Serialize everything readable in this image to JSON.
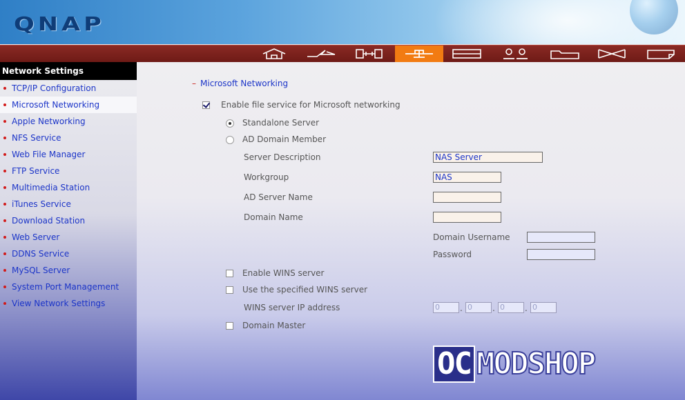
{
  "header": {
    "logo": "QNAP"
  },
  "nav": {
    "icons": [
      "home-icon",
      "lightning-icon",
      "connector-icon",
      "network-icon",
      "storage-icon",
      "users-icon",
      "folder-icon",
      "bowtie-icon",
      "document-icon"
    ],
    "active_index": 3,
    "accent_color": "#f27b12",
    "bar_color": "#7a201b"
  },
  "sidebar": {
    "title": "Network Settings",
    "items": [
      {
        "label": "TCP/IP Configuration"
      },
      {
        "label": "Microsoft Networking"
      },
      {
        "label": "Apple Networking"
      },
      {
        "label": "NFS Service"
      },
      {
        "label": "Web File Manager"
      },
      {
        "label": "FTP Service"
      },
      {
        "label": "Multimedia Station"
      },
      {
        "label": "iTunes Service"
      },
      {
        "label": "Download Station"
      },
      {
        "label": "Web Server"
      },
      {
        "label": "DDNS Service"
      },
      {
        "label": "MySQL Server"
      },
      {
        "label": "System Port Management"
      },
      {
        "label": "View Network Settings"
      }
    ],
    "selected_index": 1
  },
  "main": {
    "section_title": "Microsoft Networking",
    "enable_label": "Enable file service for Microsoft networking",
    "enable_checked": true,
    "standalone_label": "Standalone Server",
    "standalone_selected": true,
    "ad_member_label": "AD Domain Member",
    "server_description_label": "Server Description",
    "server_description_value": "NAS Server",
    "workgroup_label": "Workgroup",
    "workgroup_value": "NAS",
    "ad_server_name_label": "AD Server Name",
    "ad_server_name_value": "",
    "domain_name_label": "Domain Name",
    "domain_name_value": "",
    "domain_username_label": "Domain Username",
    "domain_username_value": "",
    "password_label": "Password",
    "password_value": "",
    "enable_wins_label": "Enable WINS server",
    "use_wins_label": "Use the specified WINS server",
    "wins_ip_label": "WINS server IP address",
    "wins_ip": [
      "0",
      "0",
      "0",
      "0"
    ],
    "domain_master_label": "Domain Master"
  },
  "watermark": {
    "part1": "OC",
    "part2": "MODSHOP"
  }
}
